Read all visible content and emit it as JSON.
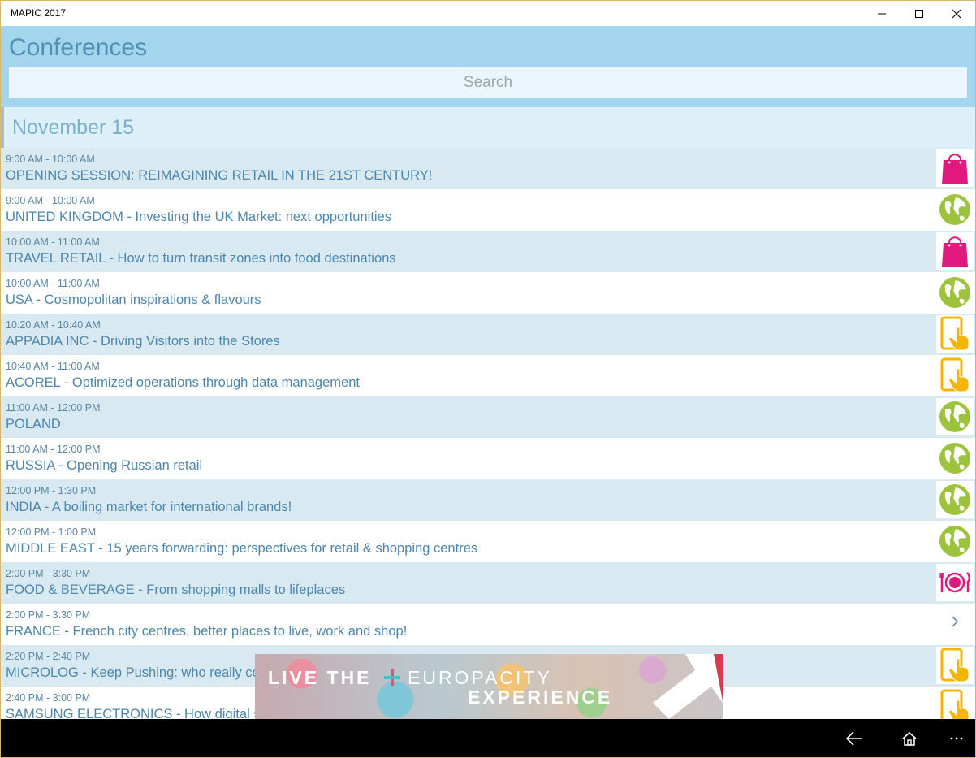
{
  "window": {
    "title": "MAPIC 2017"
  },
  "header": {
    "title": "Conferences",
    "search_placeholder": "Search"
  },
  "day": {
    "label": "November 15"
  },
  "sessions": [
    {
      "time": "9:00 AM - 10:00 AM",
      "title": "OPENING SESSION: REIMAGINING RETAIL IN THE 21ST CENTURY!",
      "icon": "shopping-bag-icon"
    },
    {
      "time": "9:00 AM - 10:00 AM",
      "title": "UNITED KINGDOM - Investing the UK Market: next opportunities",
      "icon": "globe-icon"
    },
    {
      "time": "10:00 AM - 11:00 AM",
      "title": "TRAVEL RETAIL - How to turn transit zones into food destinations",
      "icon": "shopping-bag-icon"
    },
    {
      "time": "10:00 AM - 11:00 AM",
      "title": "USA - Cosmopolitan inspirations & flavours",
      "icon": "globe-icon"
    },
    {
      "time": "10:20 AM - 10:40 AM",
      "title": "APPADIA INC - Driving Visitors into the Stores",
      "icon": "tablet-touch-icon"
    },
    {
      "time": "10:40 AM - 11:00 AM",
      "title": "ACOREL - Optimized operations through data management",
      "icon": "tablet-touch-icon"
    },
    {
      "time": "11:00 AM - 12:00 PM",
      "title": "POLAND",
      "icon": "globe-icon"
    },
    {
      "time": "11:00 AM - 12:00 PM",
      "title": "RUSSIA - Opening Russian retail",
      "icon": "globe-icon"
    },
    {
      "time": "12:00 PM - 1:30 PM",
      "title": "INDIA - A boiling market for international brands!",
      "icon": "globe-icon"
    },
    {
      "time": "12:00 PM - 1:00 PM",
      "title": "MIDDLE EAST - 15 years forwarding: perspectives for retail & shopping centres",
      "icon": "globe-icon"
    },
    {
      "time": "2:00 PM - 3:30 PM",
      "title": "FOOD & BEVERAGE - From shopping malls to lifeplaces",
      "icon": "plate-cutlery-icon"
    },
    {
      "time": "2:00 PM - 3:30 PM",
      "title": "FRANCE - French city centres, better places to live, work and shop!",
      "icon": "chevron-right-icon"
    },
    {
      "time": "2:20 PM - 2:40 PM",
      "title": "MICROLOG - Keep Pushing: who really co",
      "icon": "tablet-touch-icon"
    },
    {
      "time": "2:40 PM - 3:00 PM",
      "title": "SAMSUNG ELECTRONICS - How digital si",
      "icon": "tablet-touch-icon"
    }
  ],
  "ad": {
    "line1a": "LIVE THE",
    "line1b": "EUROPACITY",
    "line2": "EXPERIENCE"
  },
  "colors": {
    "header_bg": "#a3d5ec",
    "accent_text": "#4c86ad",
    "bag": "#e0197d",
    "globe": "#9cc33b",
    "tablet": "#f5b400"
  }
}
